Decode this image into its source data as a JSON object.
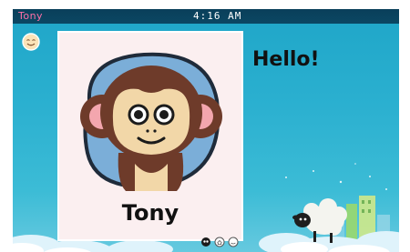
{
  "status_bar": {
    "user_name": "Tony",
    "time": "4:16 AM"
  },
  "profile_card": {
    "name": "Tony",
    "avatar_icon": "monkey-avatar-icon"
  },
  "greeting": "Hello!",
  "small_avatar_icon": "smiley-face-icon",
  "page_indicator": {
    "icons": [
      "monkey-page-dot-icon",
      "home-page-dot-icon",
      "smiley-page-dot-icon"
    ]
  },
  "colors": {
    "status_bar_bg": "#0b4763",
    "user_name_color": "#ff6fa8",
    "card_bg": "#fbeff0",
    "sky": "#2bb0d0"
  }
}
